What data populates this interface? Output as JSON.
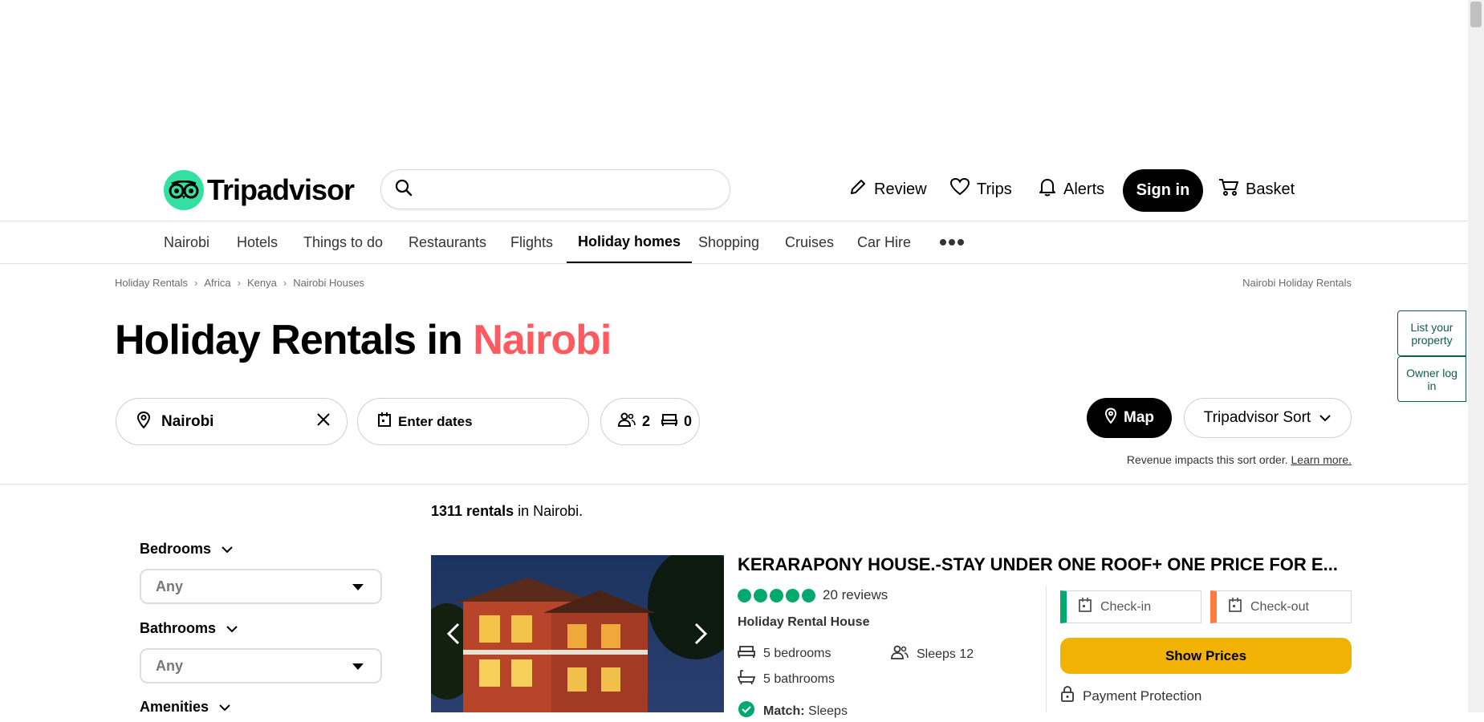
{
  "header": {
    "logo_text": "Tripadvisor",
    "search_placeholder": "",
    "nav": {
      "review": "Review",
      "trips": "Trips",
      "alerts": "Alerts",
      "sign_in": "Sign in",
      "basket": "Basket"
    }
  },
  "tabs": [
    "Nairobi",
    "Hotels",
    "Things to do",
    "Restaurants",
    "Flights",
    "Holiday homes",
    "Shopping",
    "Cruises",
    "Car Hire"
  ],
  "active_tab": "Holiday homes",
  "breadcrumb": [
    "Holiday Rentals",
    "Africa",
    "Kenya",
    "Nairobi Houses"
  ],
  "breadcrumb_right": "Nairobi Holiday Rentals",
  "title": {
    "prefix": "Holiday Rentals in ",
    "city": "Nairobi"
  },
  "search_bar": {
    "location": "Nairobi",
    "dates": "Enter dates",
    "guests": "2",
    "rooms": "0"
  },
  "map_button": "Map",
  "sort_button": "Tripadvisor Sort",
  "revenue_note": "Revenue impacts this sort order.",
  "revenue_link": "Learn more.",
  "side_tabs": {
    "list_property": "List your property",
    "owner_login": "Owner log in"
  },
  "filters": {
    "bedrooms": {
      "label": "Bedrooms",
      "value": "Any"
    },
    "bathrooms": {
      "label": "Bathrooms",
      "value": "Any"
    },
    "amenities": {
      "label": "Amenities"
    }
  },
  "results": {
    "count": "1311 rentals",
    "suffix": " in Nairobi."
  },
  "listing": {
    "title": "KERARAPONY HOUSE.-STAY UNDER ONE ROOF+ ONE PRICE FOR E...",
    "rating": 5,
    "reviews": "20 reviews",
    "type": "Holiday Rental House",
    "bedrooms": "5 bedrooms",
    "bathrooms": "5 bathrooms",
    "sleeps": "Sleeps 12",
    "match_label": "Match:",
    "match_value": "Sleeps",
    "check_in": "Check-in",
    "check_out": "Check-out",
    "show_prices": "Show Prices",
    "payment_protection": "Payment Protection"
  },
  "colors": {
    "brand_green": "#34e0a1",
    "city_red": "#ff5a5f",
    "rating_green": "#00aa6c",
    "show_prices_yellow": "#f2b203",
    "checkin_green": "#00aa6c",
    "checkout_orange": "#ff7a3d"
  }
}
